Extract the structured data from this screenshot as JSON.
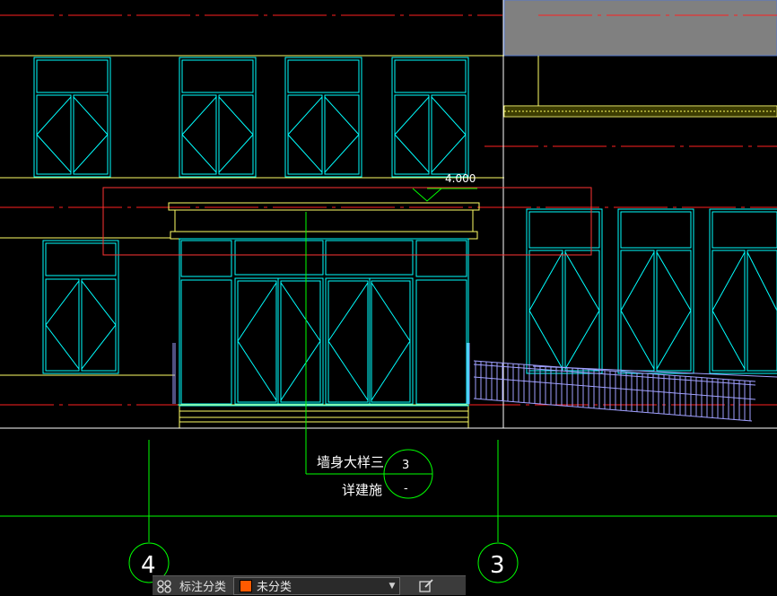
{
  "drawing": {
    "elevation_mark": "4.000",
    "callout_line1": "墙身大样三",
    "callout_line2": "详建施",
    "detail_number": "3",
    "detail_sheet": "-",
    "axis_left": "4",
    "axis_right": "3"
  },
  "colors": {
    "background": "#000000",
    "window_cyan": "#00ffff",
    "floor_yellow": "#ffff66",
    "axis_red": "#ff2020",
    "grid_green": "#00ff00",
    "railing_blue": "#a0a0ff",
    "viewport_gray": "#808080",
    "swatch_orange": "#ff5a00"
  },
  "toolbar": {
    "icon_left": "group-icon",
    "label": "标注分类",
    "selected": "未分类",
    "icon_right": "edit-icon"
  }
}
